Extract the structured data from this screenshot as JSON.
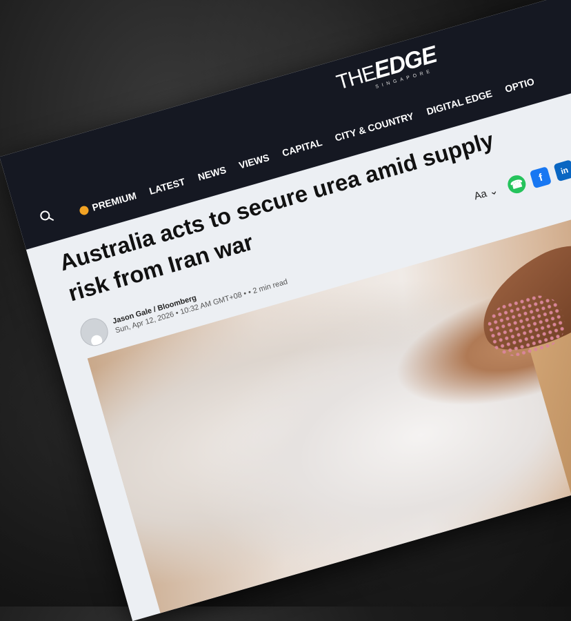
{
  "site": {
    "logo_the": "THE",
    "logo_edge": "EDGE",
    "logo_sub": "SINGAPORE"
  },
  "nav": {
    "items": [
      "PREMIUM",
      "LATEST",
      "NEWS",
      "VIEWS",
      "CAPITAL",
      "CITY & COUNTRY",
      "DIGITAL EDGE",
      "OPTIO"
    ]
  },
  "article": {
    "headline": "Australia acts to secure urea amid supply risk from Iran war",
    "author": "Jason Gale / Bloomberg",
    "date_line": "Sun, Apr 12, 2026 • 10:32 AM GMT+08 •  • 2 min read",
    "font_size_label": "Aa"
  },
  "share": {
    "whatsapp_icon": "whatsapp-icon",
    "facebook_icon": "facebook-icon",
    "linkedin_icon": "linkedin-icon"
  },
  "colors": {
    "topbar": "#151822",
    "premium": "#f2a324",
    "whatsapp": "#25c35c",
    "facebook": "#1877f2",
    "linkedin": "#0a66c2"
  }
}
